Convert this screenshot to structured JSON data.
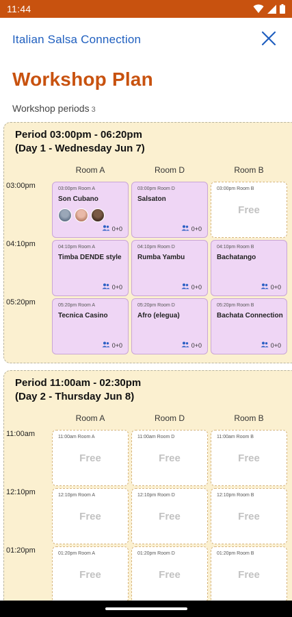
{
  "status_bar": {
    "time": "11:44",
    "icons": [
      "wifi-icon",
      "signal-icon",
      "battery-icon"
    ]
  },
  "header": {
    "app_title": "Italian Salsa Connection",
    "close_icon": "close-icon"
  },
  "page": {
    "title": "Workshop Plan",
    "periods_label": "Workshop periods",
    "periods_count": "3"
  },
  "periods": [
    {
      "title_line1": "Period 03:00pm - 06:20pm",
      "title_line2": "(Day 1 - Wednesday Jun 7)",
      "rooms": [
        "Room A",
        "Room D",
        "Room B"
      ],
      "times": [
        "03:00pm",
        "04:10pm",
        "05:20pm"
      ],
      "cells": [
        [
          {
            "meta": "03:00pm Room A",
            "name": "Son Cubano",
            "count": "0+0",
            "avatars": 3
          },
          {
            "meta": "03:00pm Room D",
            "name": "Salsaton",
            "count": "0+0"
          },
          {
            "meta": "03:00pm Room B",
            "free": "Free"
          }
        ],
        [
          {
            "meta": "04:10pm Room A",
            "name": "Timba DENDE style",
            "count": "0+0"
          },
          {
            "meta": "04:10pm Room D",
            "name": "Rumba Yambu",
            "count": "0+0"
          },
          {
            "meta": "04:10pm Room B",
            "name": "Bachatango",
            "count": "0+0"
          }
        ],
        [
          {
            "meta": "05:20pm Room A",
            "name": "Tecnica Casino",
            "count": "0+0"
          },
          {
            "meta": "05:20pm Room D",
            "name": "Afro (elegua)",
            "count": "0+0"
          },
          {
            "meta": "05:20pm Room B",
            "name": "Bachata Connection",
            "count": "0+0"
          }
        ]
      ]
    },
    {
      "title_line1": "Period 11:00am - 02:30pm",
      "title_line2": "(Day 2 - Thursday Jun 8)",
      "rooms": [
        "Room A",
        "Room D",
        "Room B"
      ],
      "times": [
        "11:00am",
        "12:10pm",
        "01:20pm"
      ],
      "cells": [
        [
          {
            "meta": "11:00am Room A",
            "free": "Free"
          },
          {
            "meta": "11:00am Room D",
            "free": "Free"
          },
          {
            "meta": "11:00am Room B",
            "free": "Free"
          }
        ],
        [
          {
            "meta": "12:10pm Room A",
            "free": "Free"
          },
          {
            "meta": "12:10pm Room D",
            "free": "Free"
          },
          {
            "meta": "12:10pm Room B",
            "free": "Free"
          }
        ],
        [
          {
            "meta": "01:20pm Room A",
            "free": "Free"
          },
          {
            "meta": "01:20pm Room D",
            "free": "Free"
          },
          {
            "meta": "01:20pm Room B",
            "free": "Free"
          }
        ]
      ]
    }
  ],
  "colors": {
    "accent": "#c8520f",
    "brand_blue": "#1f5fbf",
    "booked": "#efd6f5",
    "period_bg": "#fbf0d0"
  }
}
